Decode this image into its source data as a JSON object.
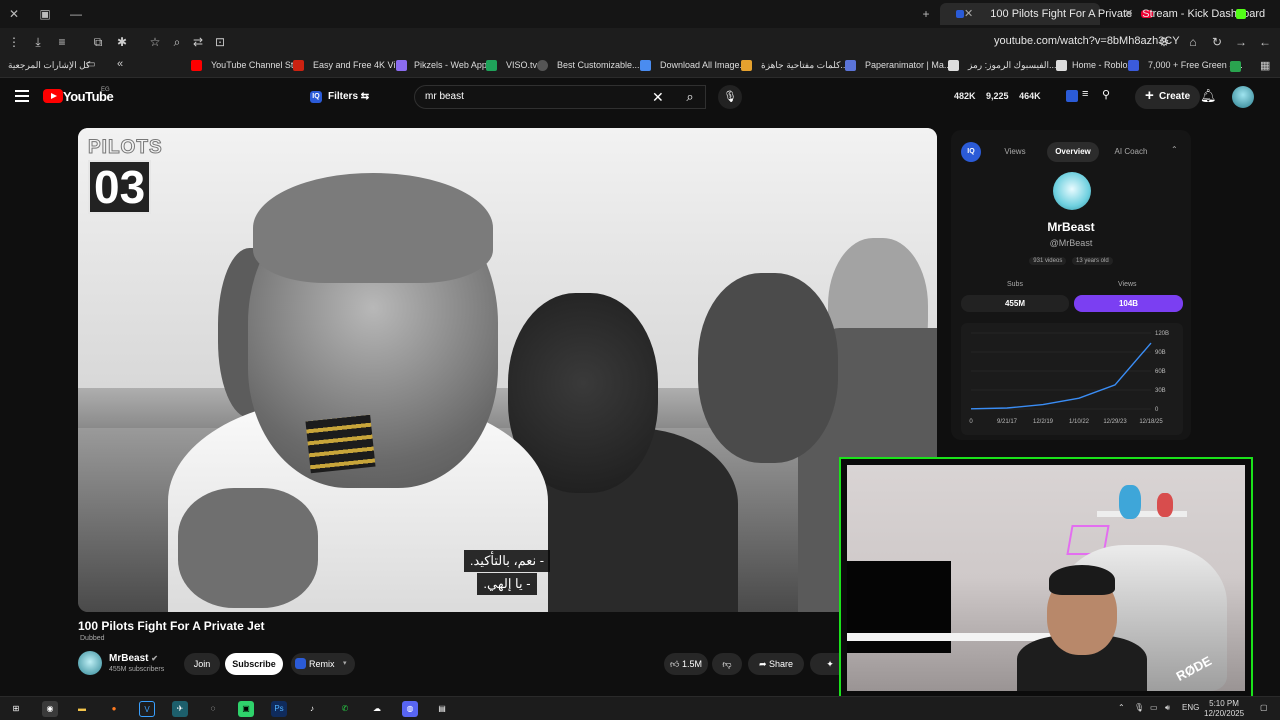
{
  "browser": {
    "tabs": [
      {
        "label": "100 Pilots Fight For A Private",
        "active": true
      },
      {
        "label": "Stream - Kick Dashboard",
        "active": false
      }
    ],
    "url": "youtube.com/watch?v=8bMh8azh3CY",
    "bookmarks": [
      "كل الإشارات المرجعية",
      "YouTube Channel St...",
      "Easy and Free 4K Vi...",
      "Pikzels - Web App",
      "VISO.tv",
      "Best Customizable...",
      "Download All Image...",
      "كلمات مفتاحية جاهزة...",
      "Paperanimator | Ma...",
      "الفيسبوك الرموز: رمز...",
      "Home - Roblox",
      "7,000 + Free Green S..."
    ]
  },
  "youtube": {
    "logo_text": "YouTube",
    "country": "EG",
    "filters_label": "Filters",
    "search_value": "mr beast",
    "header_stats": [
      "482K",
      "9,225",
      "464K"
    ],
    "create_label": "Create"
  },
  "video": {
    "badge_top": "PILOTS",
    "badge_num": "03",
    "subtitle_line1": "- نعم، بالتأكيد.",
    "subtitle_line2": "- يا إلهي.",
    "title": "100 Pilots Fight For A Private Jet",
    "dubbed": "Dubbed",
    "channel": "MrBeast",
    "subscribers": "455M subscribers",
    "join": "Join",
    "subscribe": "Subscribe",
    "remix": "Remix",
    "likes": "1.5M",
    "share": "Share"
  },
  "panel": {
    "tabs": [
      "Views",
      "Overview",
      "AI Coach"
    ],
    "active_tab": "Overview",
    "channel_name": "MrBeast",
    "handle": "@MrBeast",
    "videos": "931 videos",
    "age": "13 years old",
    "subs_label": "Subs",
    "subs_value": "455M",
    "views_label": "Views",
    "views_value": "104B",
    "accent": "#7b3ff2"
  },
  "chart_data": {
    "type": "line",
    "x": [
      "0",
      "9/21/17",
      "12/2/19",
      "1/10/22",
      "12/29/23",
      "12/18/25"
    ],
    "y_ticks": [
      "120B",
      "90B",
      "60B",
      "30B",
      "0"
    ],
    "ylim": [
      0,
      120
    ],
    "series": [
      {
        "values": [
          0.3,
          1.5,
          7,
          17,
          38,
          104
        ]
      }
    ]
  },
  "taskbar": {
    "lang": "ENG",
    "time": "5:10 PM",
    "date": "12/20/2025"
  }
}
